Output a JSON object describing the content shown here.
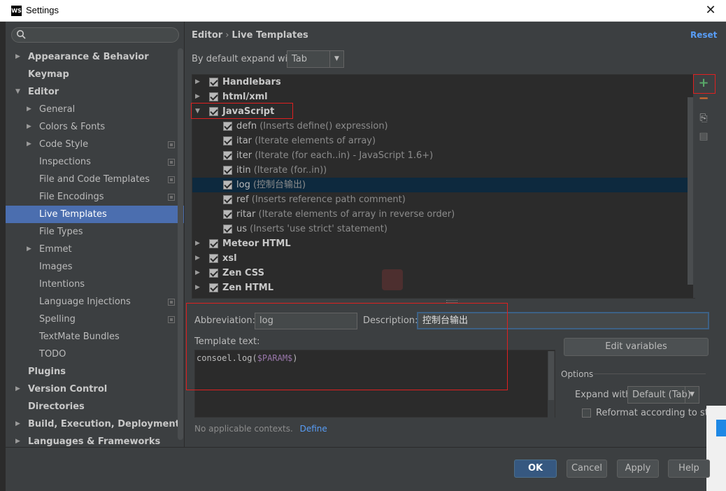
{
  "window": {
    "app_icon": "WS",
    "title": "Settings",
    "close_glyph": "✕"
  },
  "sidebar": {
    "search_placeholder": "",
    "items": [
      {
        "label": "Appearance & Behavior",
        "level": 0,
        "bold": true,
        "arrow": "▶"
      },
      {
        "label": "Keymap",
        "level": 0,
        "bold": true,
        "arrow": ""
      },
      {
        "label": "Editor",
        "level": 0,
        "bold": true,
        "arrow": "▼"
      },
      {
        "label": "General",
        "level": 1,
        "arrow": "▶"
      },
      {
        "label": "Colors & Fonts",
        "level": 1,
        "arrow": "▶"
      },
      {
        "label": "Code Style",
        "level": 1,
        "arrow": "▶",
        "project": true
      },
      {
        "label": "Inspections",
        "level": 1,
        "arrow": "",
        "project": true
      },
      {
        "label": "File and Code Templates",
        "level": 1,
        "arrow": "",
        "project": true
      },
      {
        "label": "File Encodings",
        "level": 1,
        "arrow": "",
        "project": true
      },
      {
        "label": "Live Templates",
        "level": 1,
        "arrow": "",
        "selected": true
      },
      {
        "label": "File Types",
        "level": 1,
        "arrow": ""
      },
      {
        "label": "Emmet",
        "level": 1,
        "arrow": "▶"
      },
      {
        "label": "Images",
        "level": 1,
        "arrow": ""
      },
      {
        "label": "Intentions",
        "level": 1,
        "arrow": ""
      },
      {
        "label": "Language Injections",
        "level": 1,
        "arrow": "",
        "project": true
      },
      {
        "label": "Spelling",
        "level": 1,
        "arrow": "",
        "project": true
      },
      {
        "label": "TextMate Bundles",
        "level": 1,
        "arrow": ""
      },
      {
        "label": "TODO",
        "level": 1,
        "arrow": ""
      },
      {
        "label": "Plugins",
        "level": 0,
        "bold": true,
        "arrow": ""
      },
      {
        "label": "Version Control",
        "level": 0,
        "bold": true,
        "arrow": "▶"
      },
      {
        "label": "Directories",
        "level": 0,
        "bold": true,
        "arrow": ""
      },
      {
        "label": "Build, Execution, Deployment",
        "level": 0,
        "bold": true,
        "arrow": "▶"
      },
      {
        "label": "Languages & Frameworks",
        "level": 0,
        "bold": true,
        "arrow": "▶"
      }
    ]
  },
  "header": {
    "crumb_parent": "Editor",
    "crumb_sep": "›",
    "crumb_current": "Live Templates",
    "reset": "Reset"
  },
  "expand": {
    "label": "By default expand with",
    "value": "Tab",
    "dropdown_glyph": "▼"
  },
  "templates": [
    {
      "kind": "group",
      "name": "Handlebars",
      "arrow": "▶"
    },
    {
      "kind": "group",
      "name": "html/xml",
      "arrow": "▶"
    },
    {
      "kind": "group",
      "name": "JavaScript",
      "arrow": "▼"
    },
    {
      "kind": "item",
      "abbr": "defn",
      "desc": "(Inserts define() expression)"
    },
    {
      "kind": "item",
      "abbr": "itar",
      "desc": "(Iterate elements of array)"
    },
    {
      "kind": "item",
      "abbr": "iter",
      "desc": "(Iterate (for each..in) - JavaScript 1.6+)"
    },
    {
      "kind": "item",
      "abbr": "itin",
      "desc": "(Iterate (for..in))"
    },
    {
      "kind": "item",
      "abbr": "log",
      "desc": "(控制台输出)",
      "selected": true
    },
    {
      "kind": "item",
      "abbr": "ref",
      "desc": "(Inserts reference path comment)"
    },
    {
      "kind": "item",
      "abbr": "ritar",
      "desc": "(Iterate elements of array in reverse order)"
    },
    {
      "kind": "item",
      "abbr": "us",
      "desc": "(Inserts 'use strict' statement)"
    },
    {
      "kind": "group",
      "name": "Meteor HTML",
      "arrow": "▶"
    },
    {
      "kind": "group",
      "name": "xsl",
      "arrow": "▶"
    },
    {
      "kind": "group",
      "name": "Zen CSS",
      "arrow": "▶"
    },
    {
      "kind": "group",
      "name": "Zen HTML",
      "arrow": "▶"
    }
  ],
  "tools": {
    "add": "+",
    "remove": "−",
    "copy": "⎘",
    "duplicate": "▤"
  },
  "editor": {
    "abbreviation_label": "Abbreviation:",
    "abbreviation_value": "log",
    "description_label": "Description:",
    "description_value": "控制台输出",
    "template_text_label": "Template text:",
    "code_prefix": "consoel.log(",
    "code_var": "$PARAM$",
    "code_suffix": ")",
    "edit_variables": "Edit variables",
    "options_label": "Options",
    "expand_with_label": "Expand with",
    "expand_with_value": "Default (Tab)",
    "reformat_label": "Reformat according to style",
    "contexts_text": "No applicable contexts.",
    "define_link": "Define"
  },
  "buttons": {
    "ok": "OK",
    "cancel": "Cancel",
    "apply": "Apply",
    "help": "Help"
  }
}
